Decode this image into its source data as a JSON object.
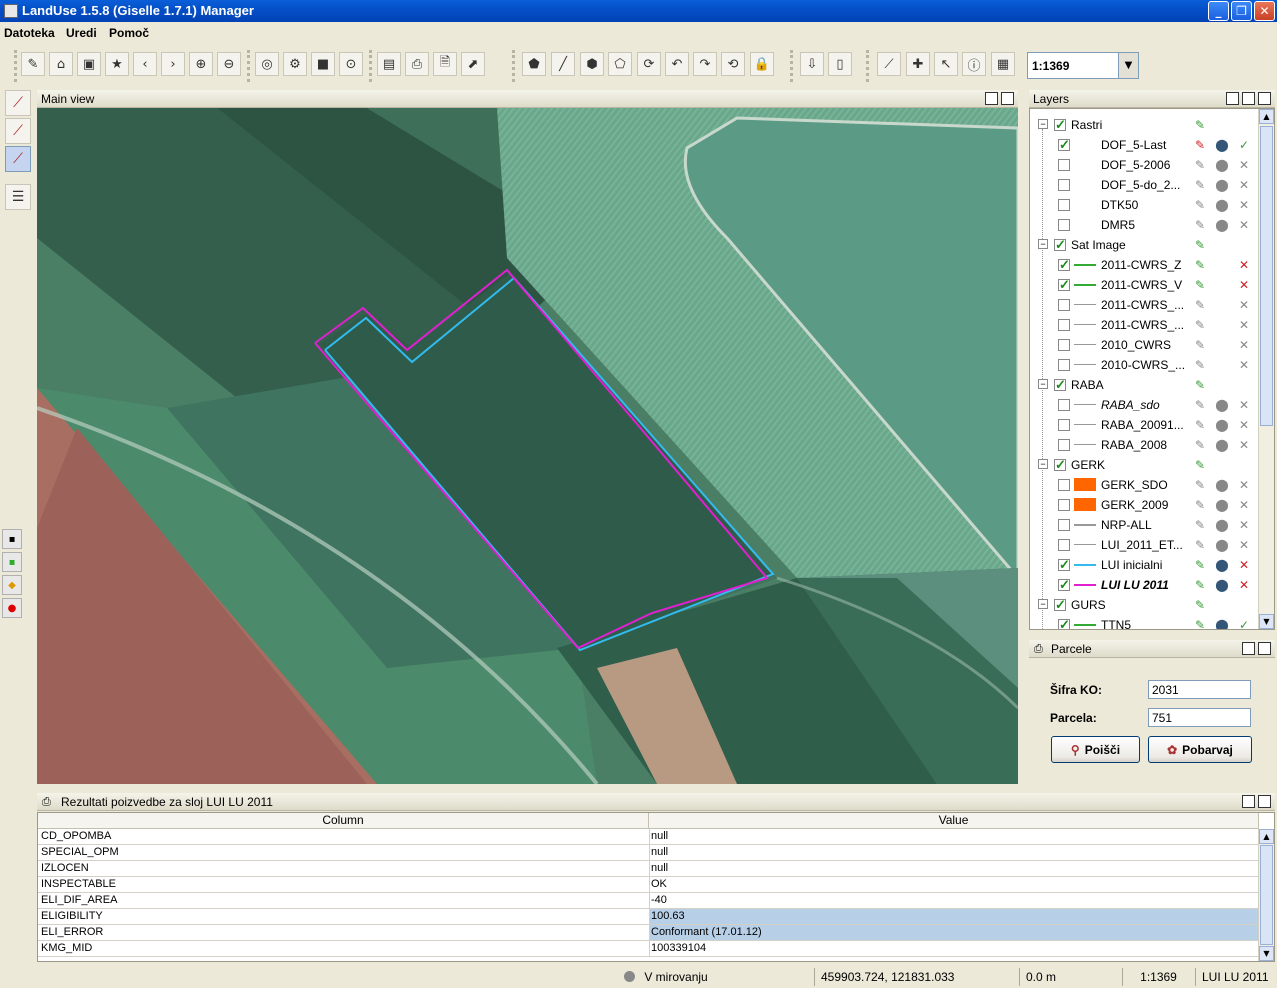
{
  "window": {
    "title": "LandUse 1.5.8 (Giselle 1.7.1) Manager"
  },
  "menu": {
    "file": "Datoteka",
    "edit": "Uredi",
    "help": "Pomoč"
  },
  "toolbar": {
    "scale_value": "1:1369"
  },
  "map": {
    "title": "Main view"
  },
  "layers": {
    "title": "Layers",
    "groups": {
      "rastri": "Rastri",
      "sat_image": "Sat Image",
      "raba": "RABA",
      "gerk": "GERK",
      "gurs": "GURS"
    },
    "items": {
      "dof_last": "DOF_5-Last",
      "dof_2006": "DOF_5-2006",
      "dof_do2": "DOF_5-do_2...",
      "dtk50": "DTK50",
      "dmr5": "DMR5",
      "cwrs_z": "2011-CWRS_Z",
      "cwrs_v": "2011-CWRS_V",
      "cwrs_3": "2011-CWRS_...",
      "cwrs_4": "2011-CWRS_...",
      "cwrs_2010": "2010_CWRS",
      "cwrs_2010b": "2010-CWRS_...",
      "raba_sdo": "RABA_sdo",
      "raba_2009": "RABA_20091...",
      "raba_2008": "RABA_2008",
      "gerk_sdo": "GERK_SDO",
      "gerk_2009": "GERK_2009",
      "nrp_all": "NRP-ALL",
      "lui_2011_et": "LUI_2011_ET...",
      "lui_inicialni": "LUI inicialni",
      "lui_lu_2011": "LUI LU 2011",
      "ttn5": "TTN5"
    },
    "colors": {
      "gerk_fill": "#ff6600",
      "lui_inicialni": "#33bbee",
      "lui_lu_2011": "#e020d0",
      "cwrs": "#33aa33"
    }
  },
  "parcel": {
    "title": "Parcele",
    "ko_label": "Šifra KO:",
    "ko_value": "2031",
    "parcel_label": "Parcela:",
    "parcel_value": "751",
    "search_label": "Poišči",
    "color_label": "Pobarvaj"
  },
  "results": {
    "title": "Rezultati poizvedbe za sloj LUI LU 2011",
    "col_column": "Column",
    "col_value": "Value",
    "rows": [
      {
        "column": "CD_OPOMBA",
        "value": "null"
      },
      {
        "column": "SPECIAL_OPM",
        "value": "null"
      },
      {
        "column": "IZLOCEN",
        "value": "null"
      },
      {
        "column": "INSPECTABLE",
        "value": "OK"
      },
      {
        "column": "ELI_DIF_AREA",
        "value": "-40"
      },
      {
        "column": "ELIGIBILITY",
        "value": "100.63"
      },
      {
        "column": "ELI_ERROR",
        "value": "Conformant (17.01.12)"
      },
      {
        "column": "KMG_MID",
        "value": "100339104"
      }
    ]
  },
  "status": {
    "state": "V mirovanju",
    "coords": "459903.724, 121831.033",
    "distance": "0.0 m",
    "scale": "1:1369",
    "layer": "LUI LU 2011"
  }
}
